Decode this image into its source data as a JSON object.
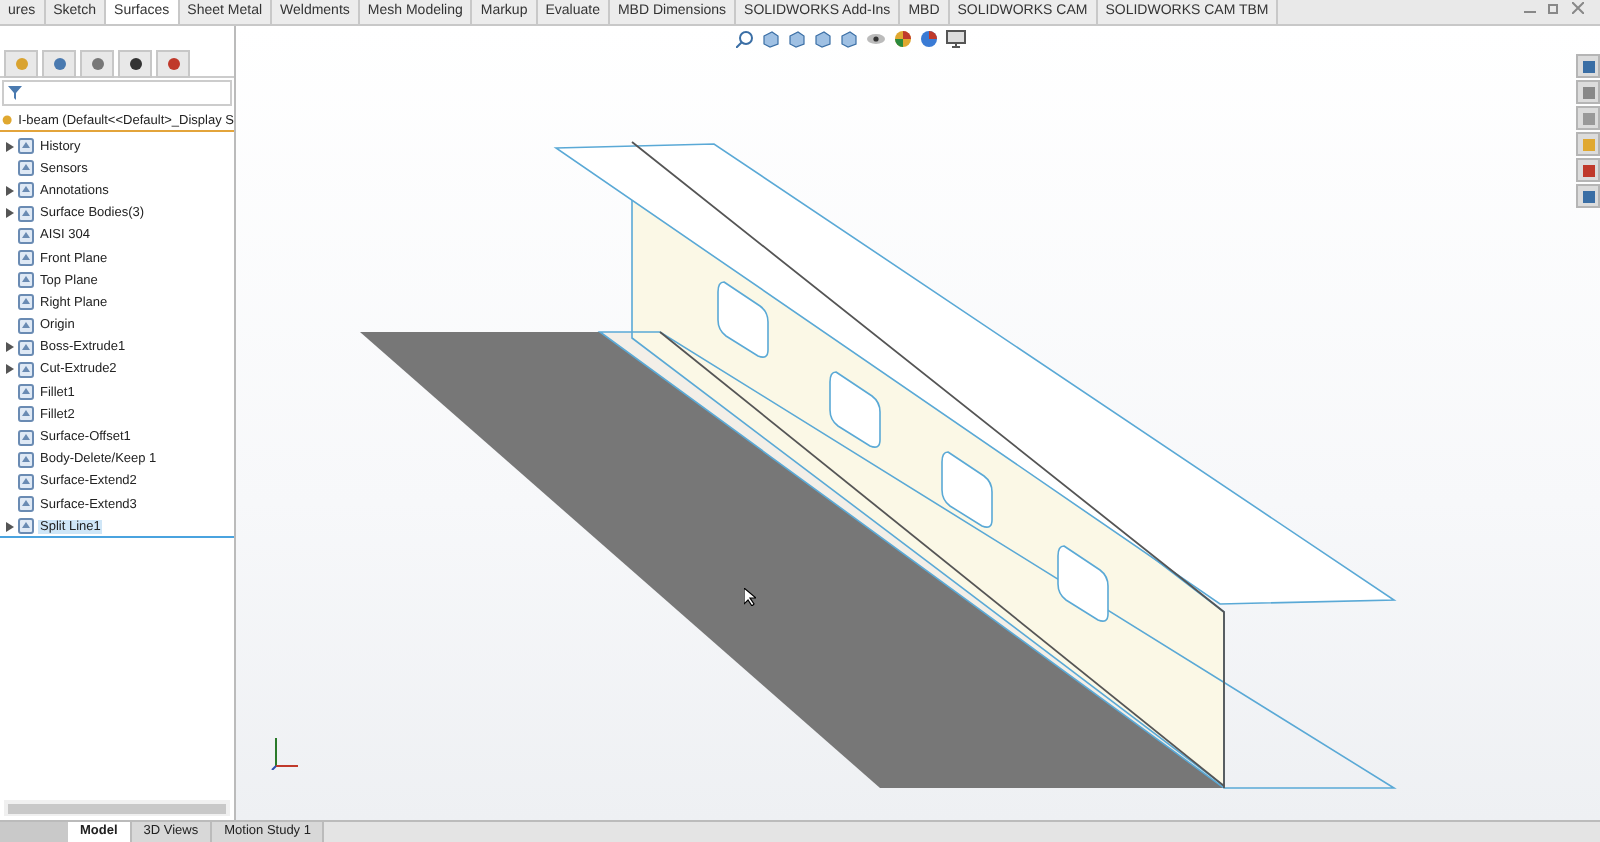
{
  "command_tabs": [
    {
      "label": "ures",
      "selected": false
    },
    {
      "label": "Sketch",
      "selected": false
    },
    {
      "label": "Surfaces",
      "selected": true
    },
    {
      "label": "Sheet Metal",
      "selected": false
    },
    {
      "label": "Weldments",
      "selected": false
    },
    {
      "label": "Mesh Modeling",
      "selected": false
    },
    {
      "label": "Markup",
      "selected": false
    },
    {
      "label": "Evaluate",
      "selected": false
    },
    {
      "label": "MBD Dimensions",
      "selected": false
    },
    {
      "label": "SOLIDWORKS Add-Ins",
      "selected": false
    },
    {
      "label": "MBD",
      "selected": false
    },
    {
      "label": "SOLIDWORKS CAM",
      "selected": false
    },
    {
      "label": "SOLIDWORKS CAM TBM",
      "selected": false
    }
  ],
  "feature_manager": {
    "root": "I-beam  (Default<<Default>_Display S",
    "items": [
      {
        "label": "History",
        "expandable": true,
        "selected": false
      },
      {
        "label": "Sensors",
        "expandable": false,
        "selected": false
      },
      {
        "label": "Annotations",
        "expandable": true,
        "selected": false
      },
      {
        "label": "Surface Bodies(3)",
        "expandable": true,
        "selected": false
      },
      {
        "label": "AISI 304",
        "expandable": false,
        "selected": false
      },
      {
        "label": "Front Plane",
        "expandable": false,
        "selected": false
      },
      {
        "label": "Top Plane",
        "expandable": false,
        "selected": false
      },
      {
        "label": "Right Plane",
        "expandable": false,
        "selected": false
      },
      {
        "label": "Origin",
        "expandable": false,
        "selected": false
      },
      {
        "label": "Boss-Extrude1",
        "expandable": true,
        "selected": false
      },
      {
        "label": "Cut-Extrude2",
        "expandable": true,
        "selected": false
      },
      {
        "label": "Fillet1",
        "expandable": false,
        "selected": false
      },
      {
        "label": "Fillet2",
        "expandable": false,
        "selected": false
      },
      {
        "label": "Surface-Offset1",
        "expandable": false,
        "selected": false
      },
      {
        "label": "Body-Delete/Keep 1",
        "expandable": false,
        "selected": false
      },
      {
        "label": "Surface-Extend2",
        "expandable": false,
        "selected": false
      },
      {
        "label": "Surface-Extend3",
        "expandable": false,
        "selected": false
      },
      {
        "label": "Split Line1",
        "expandable": true,
        "selected": true
      }
    ]
  },
  "bottom_tabs": [
    {
      "label": "Model",
      "selected": true
    },
    {
      "label": "3D Views",
      "selected": false
    },
    {
      "label": "Motion Study 1",
      "selected": false
    }
  ]
}
